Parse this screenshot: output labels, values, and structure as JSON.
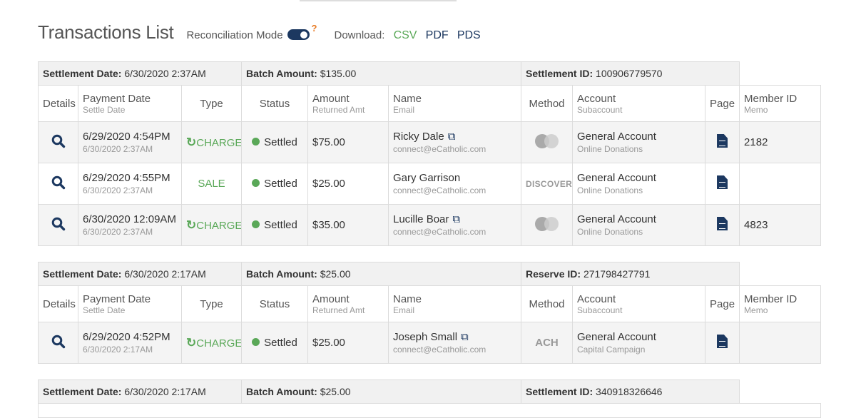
{
  "header": {
    "title": "Transactions List",
    "reconciliation_label": "Reconciliation Mode",
    "reconciliation_on": true,
    "help": "?",
    "download_label": "Download:",
    "downloads": [
      "CSV",
      "PDF",
      "PDS"
    ]
  },
  "columns": {
    "details": "Details",
    "payment_date": "Payment Date",
    "settle_date": "Settle Date",
    "type": "Type",
    "status": "Status",
    "amount": "Amount",
    "returned_amt": "Returned Amt",
    "name": "Name",
    "email": "Email",
    "method": "Method",
    "account": "Account",
    "subaccount": "Subaccount",
    "page": "Page",
    "member_id": "Member ID",
    "memo": "Memo"
  },
  "sections": [
    {
      "settlement_label": "Settlement Date:",
      "settlement_date": "6/30/2020 2:37AM",
      "batch_label": "Batch Amount:",
      "batch_amount": "$135.00",
      "id_label": "Settlement ID:",
      "id_value": "100906779570",
      "rows": [
        {
          "payment_date": "6/29/2020 4:54PM",
          "settle_date": "6/30/2020 2:37AM",
          "type": "CHARGE",
          "recurring": true,
          "status": "Settled",
          "amount": "$75.00",
          "name": "Ricky Dale",
          "external": true,
          "email": "connect@eCatholic.com",
          "method": "mastercard",
          "account": "General Account",
          "subaccount": "Online Donations",
          "member_id": "2182"
        },
        {
          "payment_date": "6/29/2020 4:55PM",
          "settle_date": "6/30/2020 2:37AM",
          "type": "SALE",
          "recurring": false,
          "status": "Settled",
          "amount": "$25.00",
          "name": "Gary Garrison",
          "external": false,
          "email": "connect@eCatholic.com",
          "method": "DISCOVER",
          "account": "General Account",
          "subaccount": "Online Donations",
          "member_id": ""
        },
        {
          "payment_date": "6/30/2020 12:09AM",
          "settle_date": "6/30/2020 2:37AM",
          "type": "CHARGE",
          "recurring": true,
          "status": "Settled",
          "amount": "$35.00",
          "name": "Lucille Boar",
          "external": true,
          "email": "connect@eCatholic.com",
          "method": "mastercard",
          "account": "General Account",
          "subaccount": "Online Donations",
          "member_id": "4823"
        }
      ]
    },
    {
      "settlement_label": "Settlement Date:",
      "settlement_date": "6/30/2020 2:17AM",
      "batch_label": "Batch Amount:",
      "batch_amount": "$25.00",
      "id_label": "Reserve ID:",
      "id_value": "271798427791",
      "rows": [
        {
          "payment_date": "6/29/2020 4:52PM",
          "settle_date": "6/30/2020 2:17AM",
          "type": "CHARGE",
          "recurring": true,
          "status": "Settled",
          "amount": "$25.00",
          "name": "Joseph Small",
          "external": true,
          "email": "connect@eCatholic.com",
          "method": "ACH",
          "account": "General Account",
          "subaccount": "Capital Campaign",
          "member_id": ""
        }
      ]
    },
    {
      "settlement_label": "Settlement Date:",
      "settlement_date": "6/30/2020 2:17AM",
      "batch_label": "Batch Amount:",
      "batch_amount": "$25.00",
      "id_label": "Settlement ID:",
      "id_value": "340918326646",
      "rows": []
    }
  ],
  "colors": {
    "accent": "#1c3860",
    "success": "#5aa858",
    "help": "#e87c26"
  }
}
